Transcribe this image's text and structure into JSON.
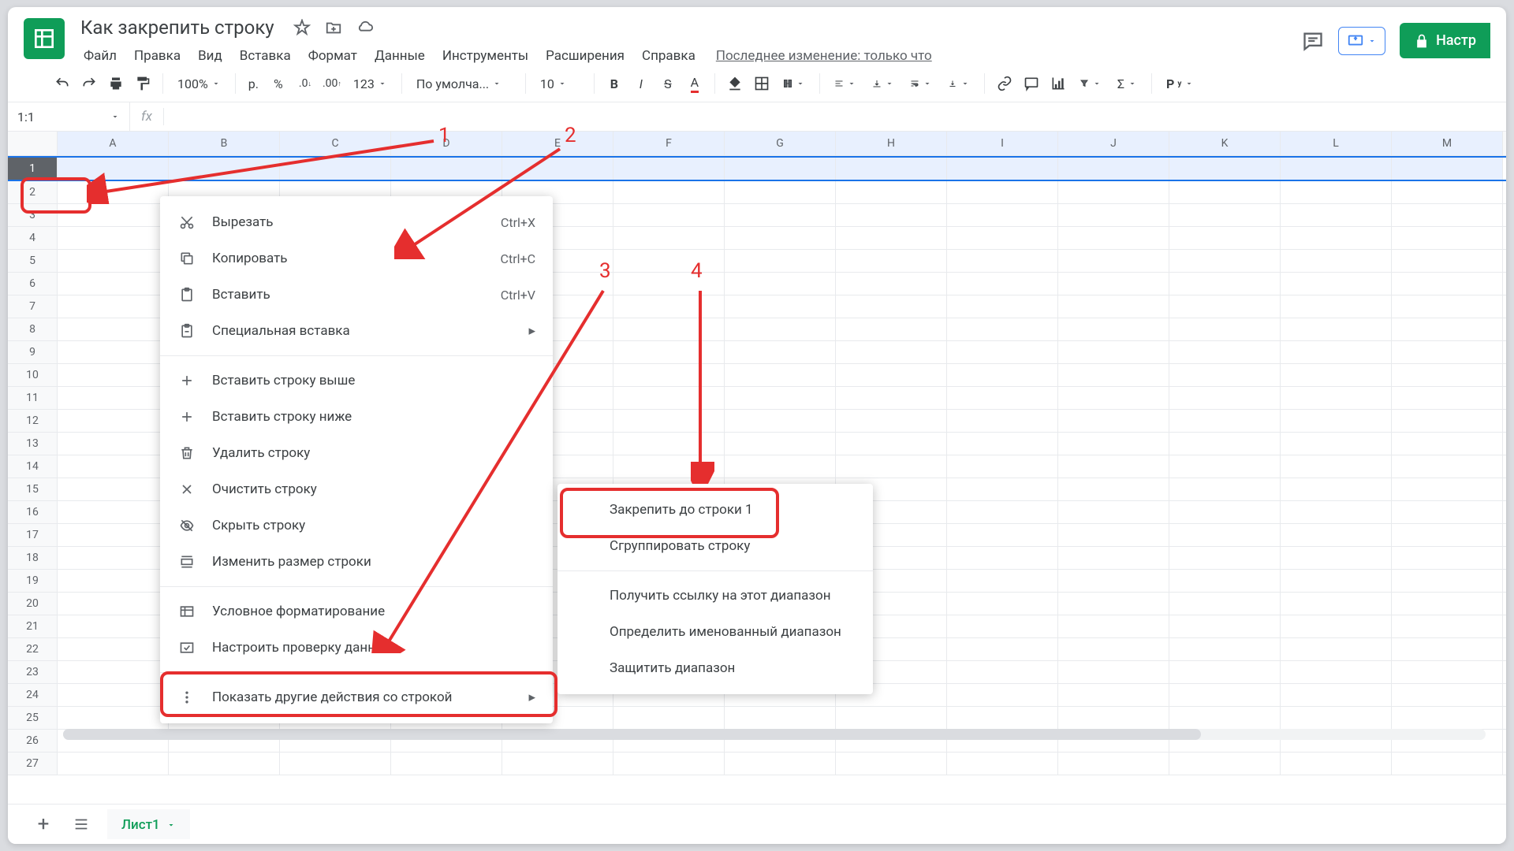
{
  "doc": {
    "title": "Как закрепить строку"
  },
  "menu": [
    "Файл",
    "Правка",
    "Вид",
    "Вставка",
    "Формат",
    "Данные",
    "Инструменты",
    "Расширения",
    "Справка"
  ],
  "last_edit": "Последнее изменение: только что",
  "share": "Настр",
  "zoom": "100%",
  "currency": "р.",
  "font_family": "По умолча...",
  "font_size": "10",
  "namebox": "1:1",
  "columns": [
    "A",
    "B",
    "C",
    "D",
    "E",
    "F",
    "G",
    "H",
    "I",
    "J",
    "K",
    "L",
    "M"
  ],
  "rows": 27,
  "sheet": "Лист1",
  "ctx_main": [
    {
      "icon": "cut",
      "label": "Вырезать",
      "shortcut": "Ctrl+X"
    },
    {
      "icon": "copy",
      "label": "Копировать",
      "shortcut": "Ctrl+C"
    },
    {
      "icon": "paste",
      "label": "Вставить",
      "shortcut": "Ctrl+V"
    },
    {
      "icon": "paste-special",
      "label": "Специальная вставка",
      "sub": true
    },
    {
      "sep": true
    },
    {
      "icon": "plus",
      "label": "Вставить строку выше"
    },
    {
      "icon": "plus",
      "label": "Вставить строку ниже"
    },
    {
      "icon": "trash",
      "label": "Удалить строку"
    },
    {
      "icon": "close",
      "label": "Очистить строку"
    },
    {
      "icon": "hide",
      "label": "Скрыть строку"
    },
    {
      "icon": "resize",
      "label": "Изменить размер строки"
    },
    {
      "sep": true
    },
    {
      "icon": "cond",
      "label": "Условное форматирование"
    },
    {
      "icon": "validate",
      "label": "Настроить проверку данных"
    },
    {
      "sep": true
    },
    {
      "icon": "more",
      "label": "Показать другие действия со строкой",
      "sub": true
    }
  ],
  "ctx_sub": [
    {
      "label": "Закрепить до строки 1"
    },
    {
      "label": "Сгруппировать строку"
    },
    {
      "sep": true
    },
    {
      "label": "Получить ссылку на этот диапазон"
    },
    {
      "label": "Определить именованный диапазон"
    },
    {
      "label": "Защитить диапазон"
    }
  ],
  "anno": {
    "1": "1",
    "2": "2",
    "3": "3",
    "4": "4"
  }
}
